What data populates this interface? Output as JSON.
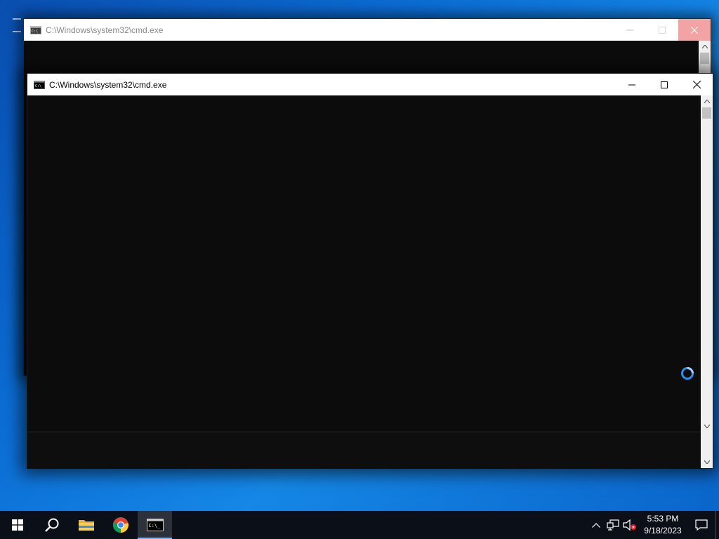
{
  "desktop": {
    "back_window": {
      "title": "C:\\Windows\\system32\\cmd.exe",
      "icon": "cmd-icon",
      "state": "inactive"
    },
    "front_window": {
      "title": "C:\\Windows\\system32\\cmd.exe",
      "icon": "cmd-icon",
      "state": "active",
      "caption_buttons": [
        "minimize",
        "maximize",
        "close"
      ]
    },
    "busy_cursor": "loading-spinner"
  },
  "taskbar": {
    "items": [
      {
        "name": "start",
        "icon": "windows-logo-icon"
      },
      {
        "name": "search",
        "icon": "search-icon"
      },
      {
        "name": "file-explorer",
        "icon": "folder-icon"
      },
      {
        "name": "chrome",
        "icon": "chrome-icon"
      },
      {
        "name": "command-prompt",
        "icon": "cmd-icon",
        "active": true
      }
    ],
    "tray": {
      "icons": [
        "chevron-up-icon",
        "network-icon",
        "volume-muted-icon"
      ],
      "time": "5:53 PM",
      "date": "9/18/2023",
      "notification_icon": "notification-icon"
    }
  },
  "colors": {
    "console_background": "#0c0c0c",
    "titlebar": "#ffffff",
    "taskbar": "#0b0f18",
    "accent": "#2f8fe6"
  }
}
